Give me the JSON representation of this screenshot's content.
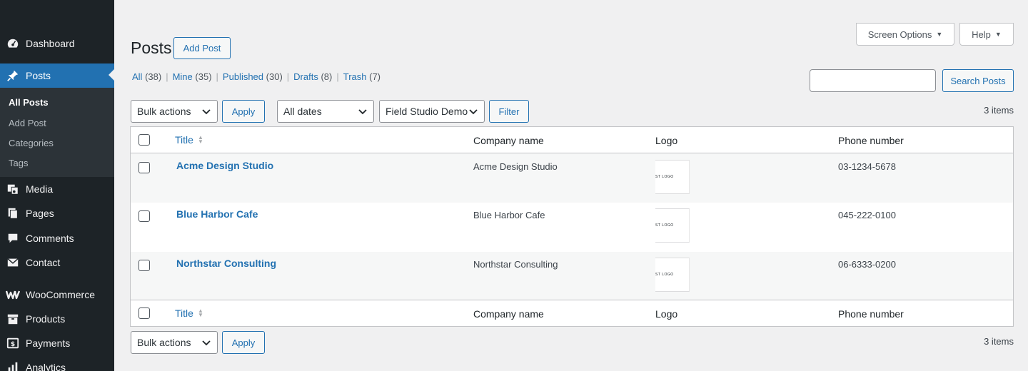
{
  "sidebar": {
    "items": [
      {
        "label": "Dashboard",
        "icon": "dashboard-icon"
      },
      {
        "label": "Posts",
        "icon": "pin-icon"
      },
      {
        "label": "Media",
        "icon": "media-icon"
      },
      {
        "label": "Pages",
        "icon": "pages-icon"
      },
      {
        "label": "Comments",
        "icon": "comments-icon"
      },
      {
        "label": "Contact",
        "icon": "mail-icon"
      },
      {
        "label": "WooCommerce",
        "icon": "woocommerce-icon"
      },
      {
        "label": "Products",
        "icon": "products-icon"
      },
      {
        "label": "Payments",
        "icon": "payments-icon"
      },
      {
        "label": "Analytics",
        "icon": "analytics-icon"
      }
    ],
    "submenu": [
      {
        "label": "All Posts"
      },
      {
        "label": "Add Post"
      },
      {
        "label": "Categories"
      },
      {
        "label": "Tags"
      }
    ]
  },
  "header": {
    "title": "Posts",
    "add_new": "Add Post",
    "screen_options": "Screen Options",
    "help": "Help"
  },
  "filters": {
    "views": [
      {
        "label": "All",
        "count": "(38)"
      },
      {
        "label": "Mine",
        "count": "(35)"
      },
      {
        "label": "Published",
        "count": "(30)"
      },
      {
        "label": "Drafts",
        "count": "(8)"
      },
      {
        "label": "Trash",
        "count": "(7)"
      }
    ],
    "bulk_actions": "Bulk actions",
    "apply": "Apply",
    "all_dates": "All dates",
    "category": "Field Studio Demo",
    "filter": "Filter",
    "search_button": "Search Posts",
    "items_count": "3 items"
  },
  "table": {
    "columns": [
      "Title",
      "Company name",
      "Logo",
      "Phone number"
    ],
    "rows": [
      {
        "title": "Acme Design Studio",
        "company": "Acme Design Studio",
        "logo_text": "ST   LOGO",
        "phone": "03-1234-5678"
      },
      {
        "title": "Blue Harbor Cafe",
        "company": "Blue Harbor Cafe",
        "logo_text": "ST   LOGO",
        "phone": "045-222-0100"
      },
      {
        "title": "Northstar Consulting",
        "company": "Northstar Consulting",
        "logo_text": "ST   LOGO",
        "phone": "06-6333-0200"
      }
    ]
  },
  "bottom": {
    "bulk_actions": "Bulk actions",
    "apply": "Apply",
    "items_count": "3 items"
  },
  "colors": {
    "sidebar_bg": "#1d2327",
    "accent": "#2271b1",
    "page_bg": "#f0f0f1"
  }
}
